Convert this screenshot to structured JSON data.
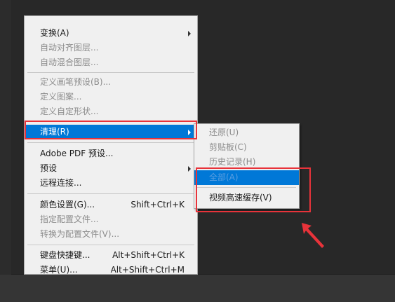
{
  "menu": {
    "items": [
      {
        "label": "变换(A)",
        "disabled": false,
        "submenu": true
      },
      {
        "label": "自动对齐图层...",
        "disabled": true
      },
      {
        "label": "自动混合图层...",
        "disabled": true
      },
      {
        "label": "定义画笔预设(B)...",
        "disabled": true
      },
      {
        "label": "定义图案...",
        "disabled": true
      },
      {
        "label": "定义自定形状...",
        "disabled": true
      },
      {
        "label": "清理(R)",
        "selected": true,
        "submenu": true
      },
      {
        "label": "Adobe PDF 预设..."
      },
      {
        "label": "预设",
        "submenu": true
      },
      {
        "label": "远程连接..."
      },
      {
        "label": "颜色设置(G)...",
        "shortcut": "Shift+Ctrl+K"
      },
      {
        "label": "指定配置文件...",
        "disabled": true
      },
      {
        "label": "转换为配置文件(V)...",
        "disabled": true
      },
      {
        "label": "键盘快捷键...",
        "shortcut": "Alt+Shift+Ctrl+K"
      },
      {
        "label": "菜单(U)...",
        "shortcut": "Alt+Shift+Ctrl+M"
      }
    ]
  },
  "submenu": {
    "items": [
      {
        "label": "还原(U)",
        "disabled": true
      },
      {
        "label": "剪贴板(C)",
        "disabled": true
      },
      {
        "label": "历史记录(H)",
        "disabled": true
      },
      {
        "label": "全部(A)",
        "selected": true
      },
      {
        "label": "视频高速缓存(V)"
      }
    ]
  },
  "colors": {
    "background": "#282828",
    "menu_bg": "#f0f0f0",
    "selection": "#0078d7",
    "highlight_red": "#e8333a",
    "disabled_text": "#8c8c8c"
  }
}
